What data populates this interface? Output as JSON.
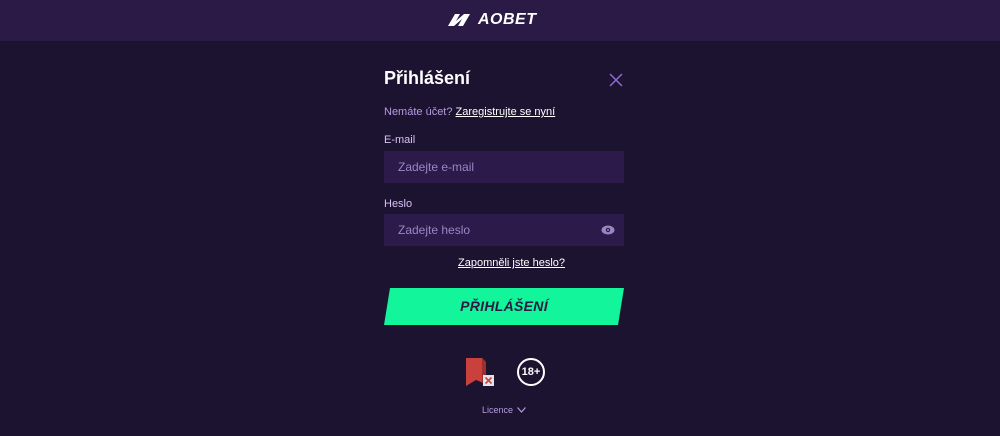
{
  "header": {
    "logo_text": "AOBET",
    "logo_icon": "aobet-logo-mark-icon"
  },
  "login_modal": {
    "title": "Přihlášení",
    "close_icon": "close-icon",
    "no_account_text": "Nemáte účet?",
    "register_link": "Zaregistrujte se nyní",
    "email": {
      "label": "E-mail",
      "placeholder": "Zadejte e-mail",
      "value": ""
    },
    "password": {
      "label": "Heslo",
      "placeholder": "Zadejte heslo",
      "value": "",
      "toggle_icon": "eye-icon"
    },
    "forgot_password_link": "Zapomněli jste heslo?",
    "submit_label": "PŘIHLÁŠENÍ",
    "badges": {
      "license_badge_icon": "license-badge-icon",
      "age_badge": "18+"
    },
    "licence_toggle": "Licence",
    "licence_toggle_icon": "chevron-down-icon"
  },
  "colors": {
    "page_background": "#1c1330",
    "header_background": "#2a1a45",
    "input_background": "#2c1b4a",
    "accent_green": "#12f59a",
    "muted_purple_text": "#b59be0",
    "close_icon_color": "#8c6cd0"
  }
}
